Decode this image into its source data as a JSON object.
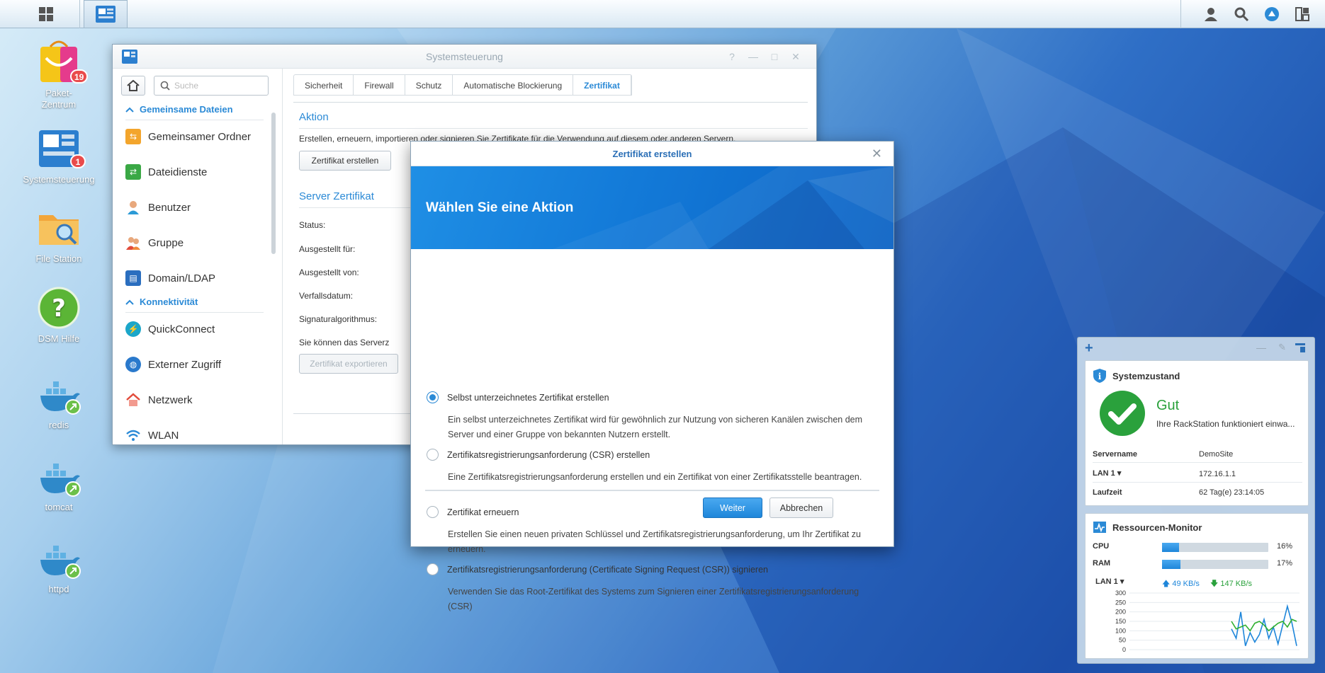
{
  "taskbar": {
    "main_menu_icon": "grid-icon",
    "active_app_icon": "control-panel-icon",
    "tray_icons": [
      "user-icon",
      "search-icon",
      "dsm-icon",
      "widgets-icon"
    ]
  },
  "desktop": {
    "icons": [
      {
        "label": "Paket-Zentrum",
        "badge": "19"
      },
      {
        "label": "Systemsteuerung",
        "badge": "1"
      },
      {
        "label": "File Station",
        "badge": ""
      },
      {
        "label": "DSM Hilfe",
        "badge": ""
      },
      {
        "label": "redis",
        "badge": ""
      },
      {
        "label": "tomcat",
        "badge": ""
      },
      {
        "label": "httpd",
        "badge": ""
      }
    ]
  },
  "window": {
    "title": "Systemsteuerung",
    "controls": [
      "?",
      "—",
      "□",
      "✕"
    ],
    "search_placeholder": "Suche",
    "sidebar": {
      "sections": [
        {
          "title": "Gemeinsame Dateien",
          "items": [
            "Gemeinsamer Ordner",
            "Dateidienste",
            "Benutzer",
            "Gruppe",
            "Domain/LDAP"
          ]
        },
        {
          "title": "Konnektivität",
          "items": [
            "QuickConnect",
            "Externer Zugriff",
            "Netzwerk",
            "WLAN"
          ]
        }
      ]
    },
    "tabs": [
      "Sicherheit",
      "Firewall",
      "Schutz",
      "Automatische Blockierung",
      "Zertifikat"
    ],
    "active_tab": "Zertifikat",
    "aktion_title": "Aktion",
    "aktion_text": "Erstellen, erneuern, importieren oder signieren Sie Zertifikate für die Verwendung auf diesem oder anderen Servern.",
    "create_button": "Zertifikat erstellen",
    "server_cert_title": "Server Zertifikat",
    "fields": [
      "Status:",
      "Ausgestellt für:",
      "Ausgestellt von:",
      "Verfallsdatum:",
      "Signaturalgorithmus:"
    ],
    "export_text": "Sie können das Serverz",
    "export_button": "Zertifikat exportieren"
  },
  "dialog": {
    "title": "Zertifikat erstellen",
    "heading": "Wählen Sie eine Aktion",
    "options": [
      {
        "label": "Selbst unterzeichnetes Zertifikat erstellen",
        "desc": "Ein selbst unterzeichnetes Zertifikat wird für gewöhnlich zur Nutzung von sicheren Kanälen zwischen dem Server und einer Gruppe von bekannten Nutzern erstellt.",
        "selected": true
      },
      {
        "label": "Zertifikatsregistrierungsanforderung (CSR) erstellen",
        "desc": "Eine Zertifikatsregistrierungsanforderung erstellen und ein Zertifikat von einer Zertifikatsstelle beantragen.",
        "selected": false
      },
      {
        "label": "Zertifikat erneuern",
        "desc": "Erstellen Sie einen neuen privaten Schlüssel und Zertifikatsregistrierungsanforderung, um Ihr Zertifikat zu erneuern.",
        "selected": false
      },
      {
        "label": "Zertifikatsregistrierungsanforderung (Certificate Signing Request (CSR)) signieren",
        "desc": "Verwenden Sie das Root-Zertifikat des Systems zum Signieren einer Zertifikatsregistrierungsanforderung (CSR)",
        "selected": false
      }
    ],
    "next_button": "Weiter",
    "cancel_button": "Abbrechen"
  },
  "widgets": {
    "add_label": "+",
    "health": {
      "title": "Systemzustand",
      "status": "Gut",
      "message": "Ihre RackStation funktioniert einwa...",
      "rows": [
        {
          "key": "Servername",
          "value": "DemoSite"
        },
        {
          "key": "LAN 1",
          "value": "172.16.1.1"
        },
        {
          "key": "Laufzeit",
          "value": "62 Tag(e) 23:14:05"
        }
      ]
    },
    "resources": {
      "title": "Ressourcen-Monitor",
      "cpu_label": "CPU",
      "cpu_percent": 16,
      "cpu_text": "16%",
      "ram_label": "RAM",
      "ram_percent": 17,
      "ram_text": "17%",
      "lan_label": "LAN 1",
      "upload": "49 KB/s",
      "download": "147 KB/s",
      "y_ticks": [
        "300",
        "250",
        "200",
        "150",
        "100",
        "50",
        "0"
      ]
    }
  },
  "chart_data": {
    "type": "line",
    "ylim": [
      0,
      300
    ],
    "series": [
      {
        "color": "#1e86da",
        "values": [
          110,
          60,
          200,
          20,
          90,
          40,
          80,
          160,
          60,
          120,
          30,
          130,
          230,
          140,
          20
        ]
      },
      {
        "color": "#30b030",
        "values": [
          150,
          110,
          120,
          130,
          100,
          140,
          150,
          130,
          100,
          120,
          140,
          150,
          120,
          160,
          150
        ]
      }
    ]
  }
}
